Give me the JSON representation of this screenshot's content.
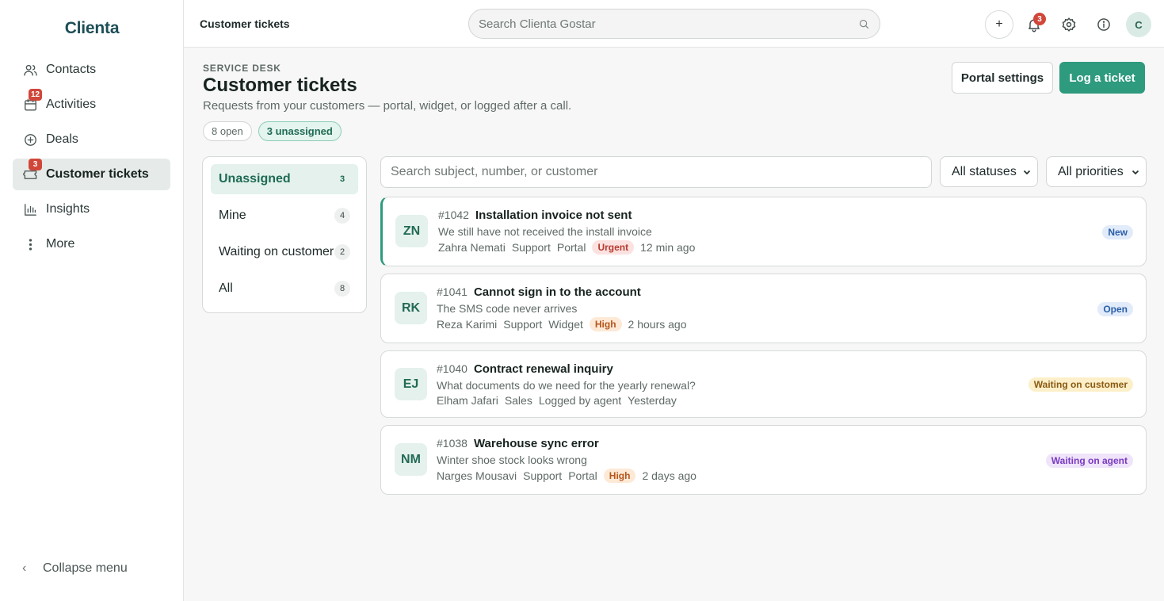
{
  "app": {
    "name": "Clienta"
  },
  "sidebar": {
    "items": [
      {
        "label": "Contacts",
        "icon": "users-icon",
        "badge": null,
        "active": false
      },
      {
        "label": "Activities",
        "icon": "calendar-icon",
        "badge": "12",
        "active": false
      },
      {
        "label": "Deals",
        "icon": "plus-circle-icon",
        "badge": null,
        "active": false
      },
      {
        "label": "Customer tickets",
        "icon": "ticket-icon",
        "badge": "3",
        "active": true
      },
      {
        "label": "Insights",
        "icon": "bar-chart-icon",
        "badge": null,
        "active": false
      },
      {
        "label": "More",
        "icon": "more-vertical-icon",
        "badge": null,
        "active": false
      }
    ],
    "collapse_label": "Collapse menu"
  },
  "topbar": {
    "title": "Customer tickets",
    "search_placeholder": "Search Clienta Gostar",
    "add_label": "+",
    "notifications_count": "3",
    "avatar_initial": "C"
  },
  "header": {
    "eyebrow": "SERVICE DESK",
    "title": "Customer tickets",
    "subtitle": "Requests from your customers — portal, widget, or logged after a call.",
    "chip_open": "8 open",
    "chip_unassigned": "3 unassigned",
    "portal_settings_label": "Portal settings",
    "log_ticket_label": "Log a ticket"
  },
  "views": [
    {
      "label": "Unassigned",
      "count": "3",
      "active": true
    },
    {
      "label": "Mine",
      "count": "4",
      "active": false
    },
    {
      "label": "Waiting on customer",
      "count": "2",
      "active": false
    },
    {
      "label": "All",
      "count": "8",
      "active": false
    }
  ],
  "filters": {
    "search_placeholder": "Search subject, number, or customer",
    "status_selected": "All statuses",
    "priority_selected": "All priorities"
  },
  "tickets": [
    {
      "initials": "ZN",
      "number": "#1042",
      "subject": "Installation invoice not sent",
      "preview": "We still have not received the install invoice",
      "customer": "Zahra Nemati",
      "team": "Support",
      "channel": "Portal",
      "priority": "Urgent",
      "time": "12 min ago",
      "status": "New"
    },
    {
      "initials": "RK",
      "number": "#1041",
      "subject": "Cannot sign in to the account",
      "preview": "The SMS code never arrives",
      "customer": "Reza Karimi",
      "team": "Support",
      "channel": "Widget",
      "priority": "High",
      "time": "2 hours ago",
      "status": "Open"
    },
    {
      "initials": "EJ",
      "number": "#1040",
      "subject": "Contract renewal inquiry",
      "preview": "What documents do we need for the yearly renewal?",
      "customer": "Elham Jafari",
      "team": "Sales",
      "channel": "Logged by agent",
      "priority": "",
      "time": "Yesterday",
      "status": "Waiting on customer"
    },
    {
      "initials": "NM",
      "number": "#1038",
      "subject": "Warehouse sync error",
      "preview": "Winter shoe stock looks wrong",
      "customer": "Narges Mousavi",
      "team": "Support",
      "channel": "Portal",
      "priority": "High",
      "time": "2 days ago",
      "status": "Waiting on agent"
    }
  ],
  "colors": {
    "brand": "#1d4e56",
    "accent": "#2e9a7e",
    "badge": "#d0473a"
  }
}
